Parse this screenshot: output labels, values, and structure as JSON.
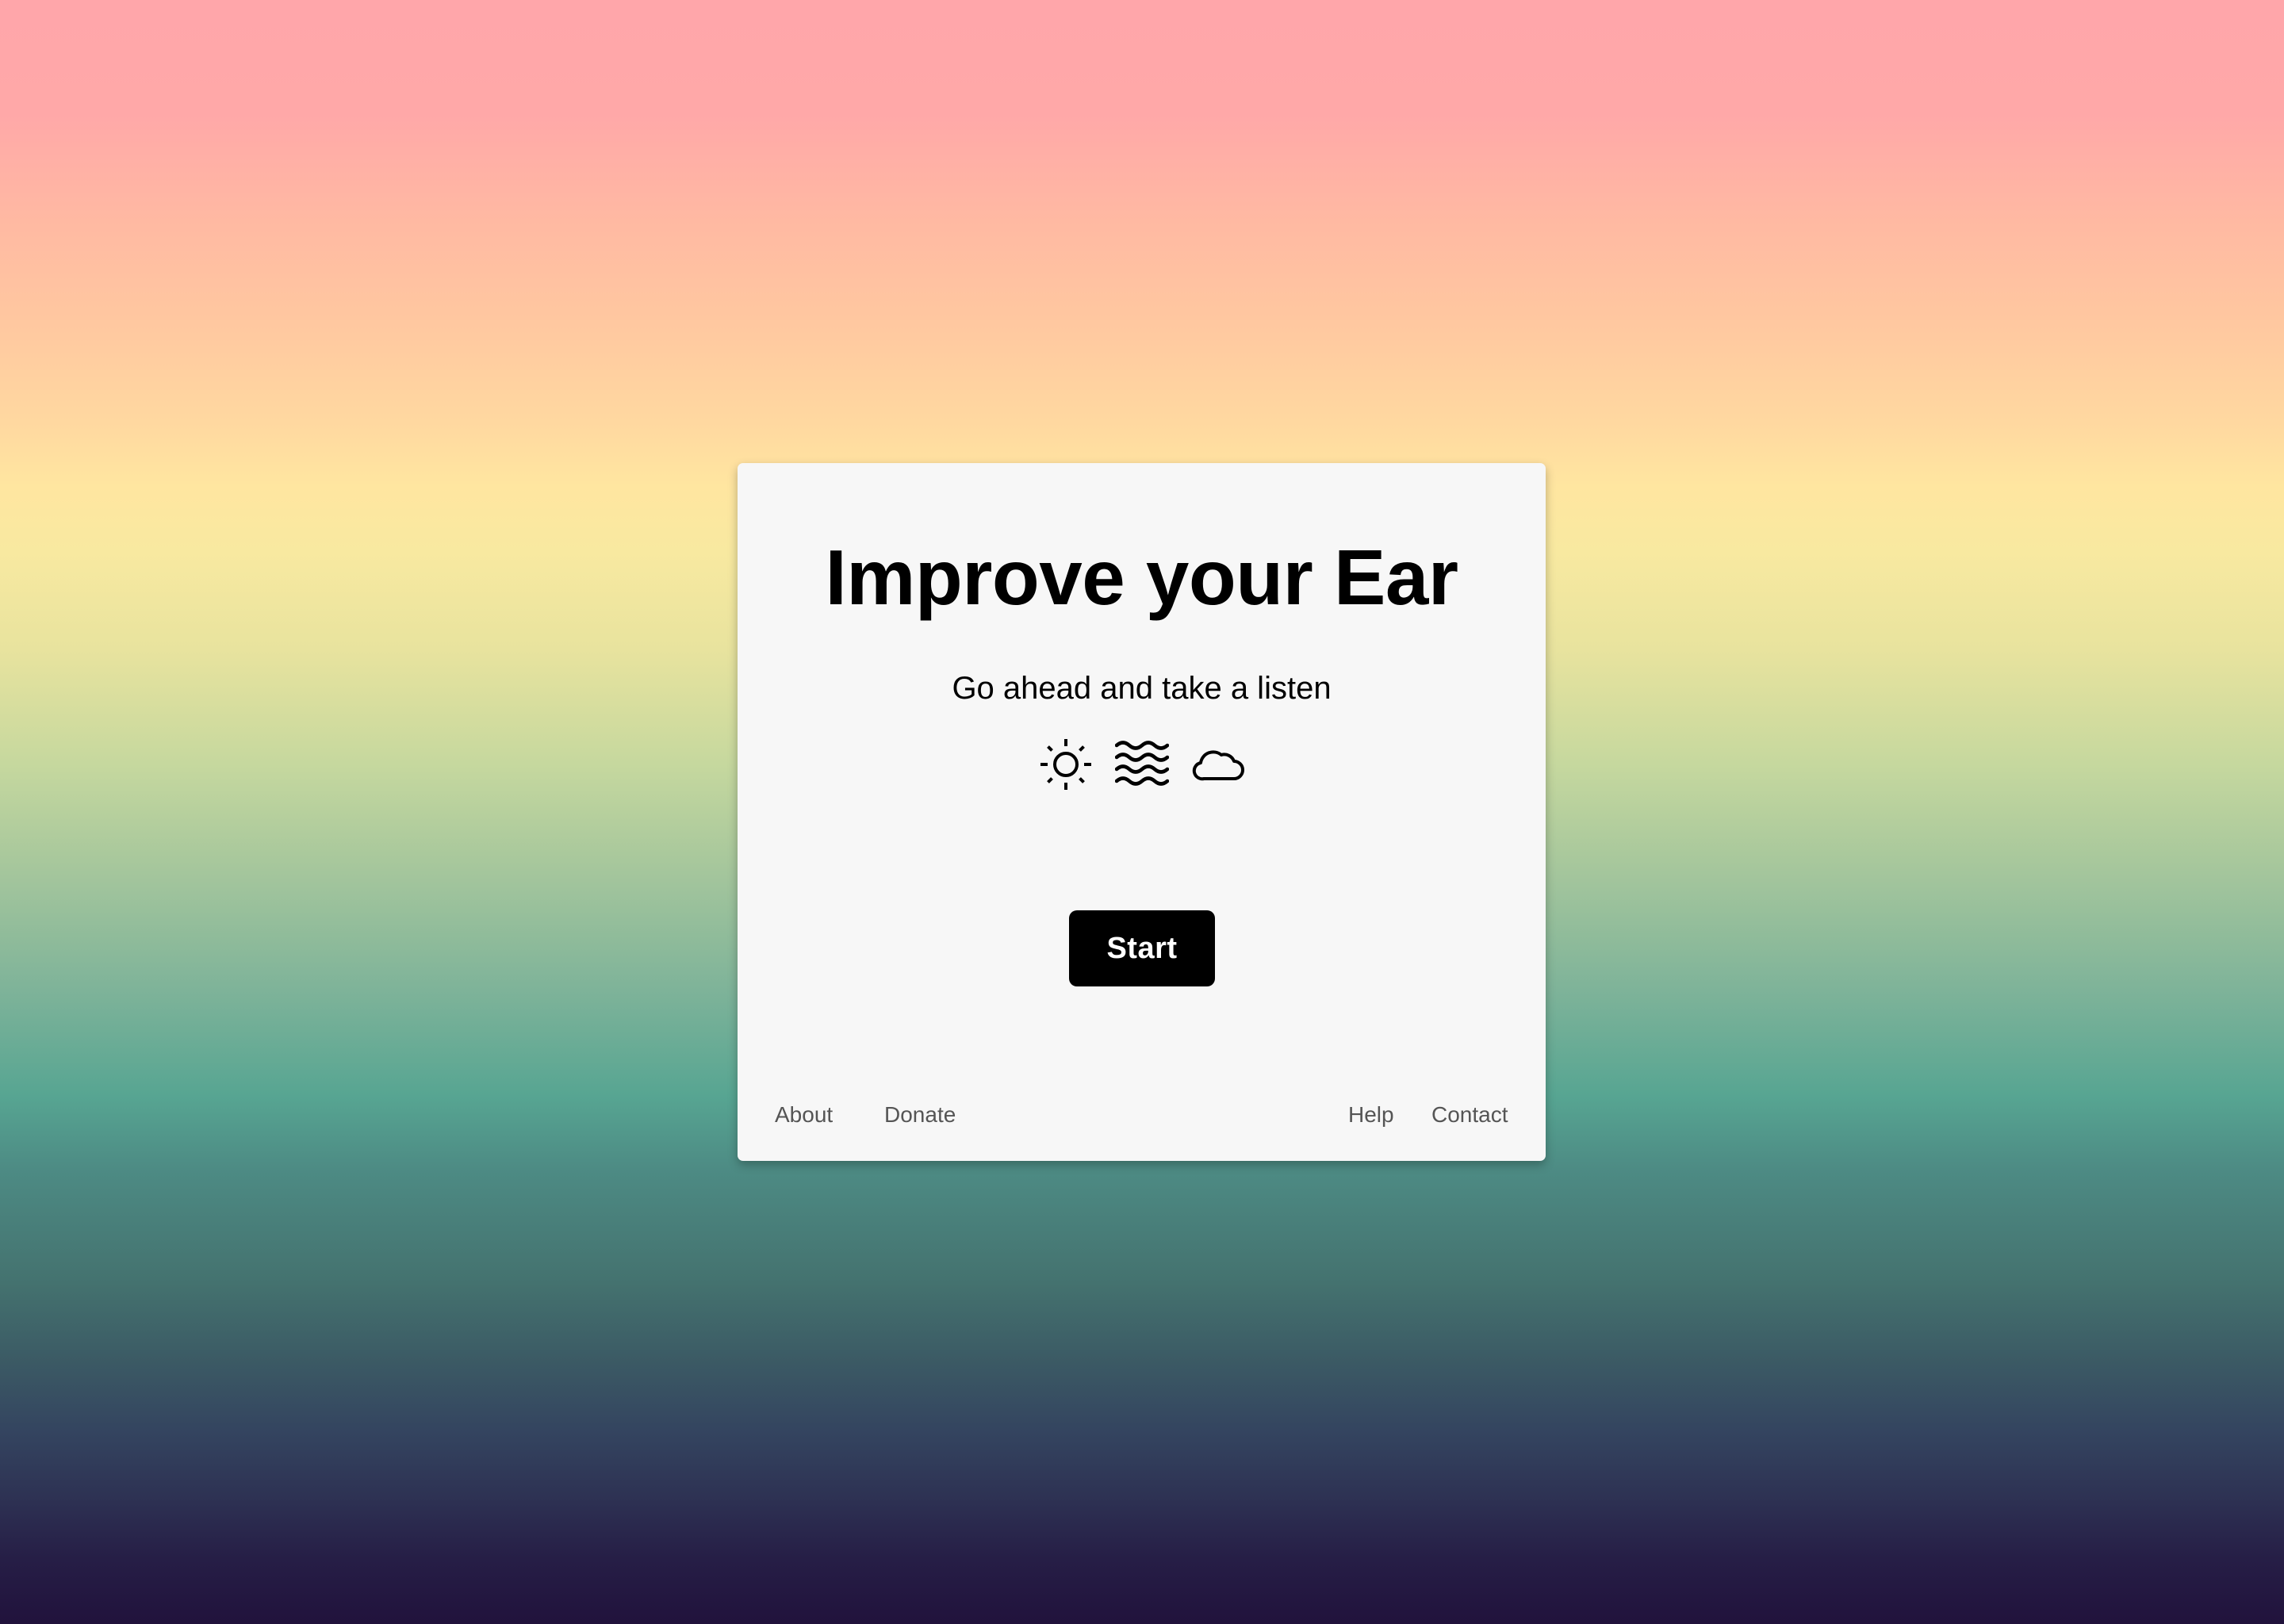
{
  "main": {
    "title": "Improve your Ear",
    "subtitle": "Go ahead and take a listen",
    "icons": [
      "sun-icon",
      "waves-icon",
      "cloud-icon"
    ],
    "start_label": "Start"
  },
  "footer": {
    "left_links": [
      "About",
      "Donate"
    ],
    "right_links": [
      "Help",
      "Contact"
    ]
  },
  "colors": {
    "card_background": "#f7f7f7",
    "button_background": "#000000",
    "button_text": "#ffffff",
    "footer_link": "#555555",
    "gradient_top": "#ffa6aa",
    "gradient_middle": "#57a592",
    "gradient_bottom": "#21123c"
  }
}
